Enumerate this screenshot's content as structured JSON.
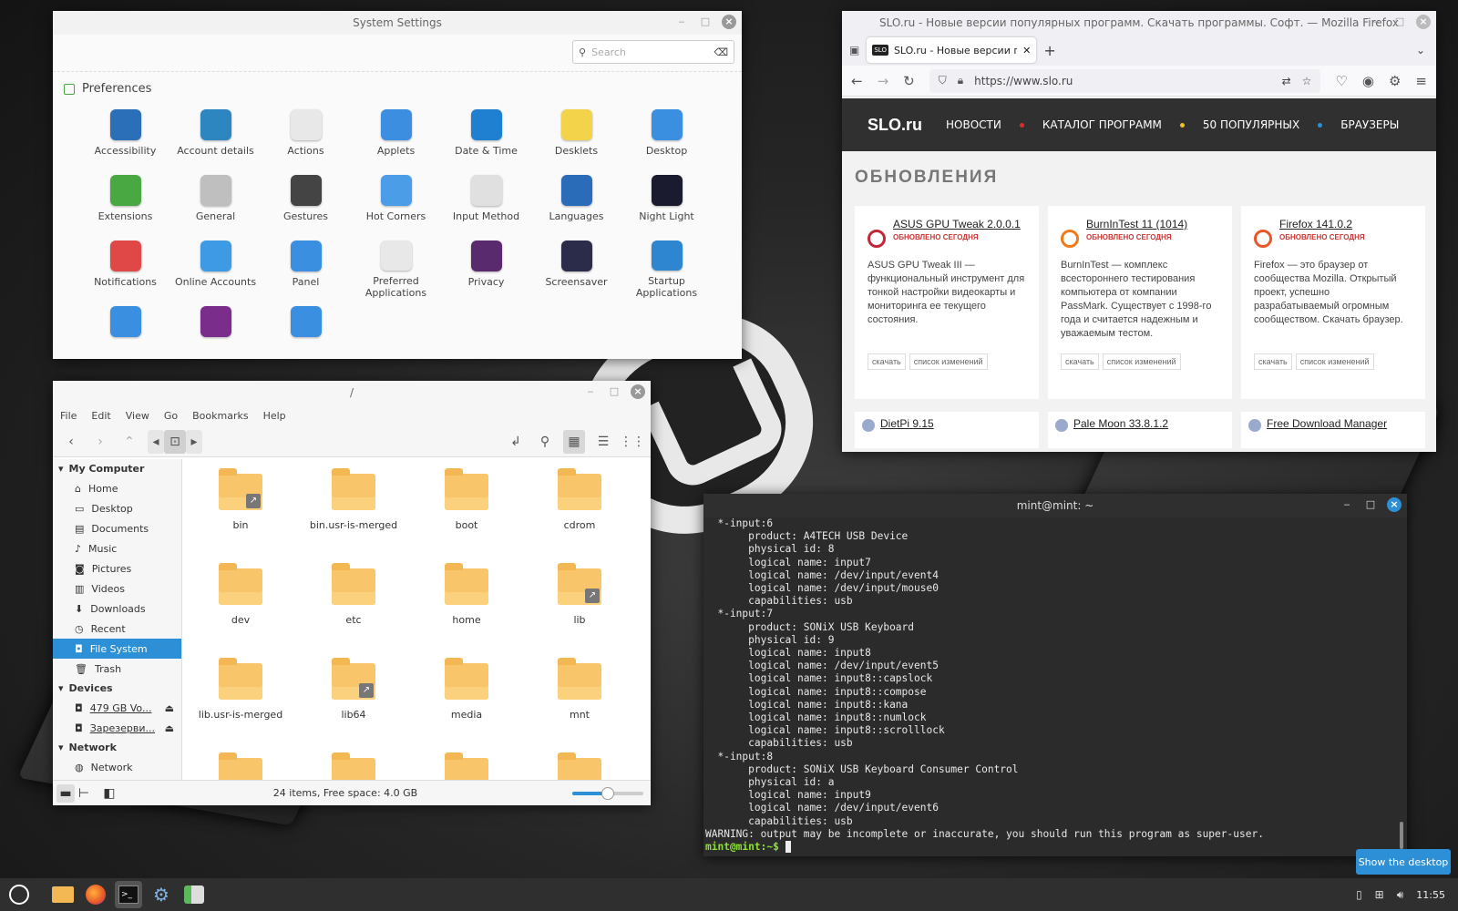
{
  "settings": {
    "title": "System Settings",
    "search_placeholder": "Search",
    "section": "Preferences",
    "items": [
      {
        "label": "Accessibility",
        "icon": "accessibility-icon",
        "color": "#2a6fb8"
      },
      {
        "label": "Account details",
        "icon": "user-icon",
        "color": "#2e86c1"
      },
      {
        "label": "Actions",
        "icon": "list-icon",
        "color": "#e8e8e8"
      },
      {
        "label": "Applets",
        "icon": "applets-icon",
        "color": "#3b8ee0"
      },
      {
        "label": "Date & Time",
        "icon": "clock-icon",
        "color": "#1f7fd1"
      },
      {
        "label": "Desklets",
        "icon": "note-icon",
        "color": "#f2d34a"
      },
      {
        "label": "Desktop",
        "icon": "desktop-icon",
        "color": "#3a8fe0"
      },
      {
        "label": "Extensions",
        "icon": "puzzle-icon",
        "color": "#4aa843"
      },
      {
        "label": "General",
        "icon": "toggle-icon",
        "color": "#bfbfbf"
      },
      {
        "label": "Gestures",
        "icon": "hand-icon",
        "color": "#444444"
      },
      {
        "label": "Hot Corners",
        "icon": "corner-icon",
        "color": "#4a9de6"
      },
      {
        "label": "Input Method",
        "icon": "input-method-icon",
        "color": "#e0e0e0"
      },
      {
        "label": "Languages",
        "icon": "globe-icon",
        "color": "#2b6cb8"
      },
      {
        "label": "Night Light",
        "icon": "moon-icon",
        "color": "#1b1b2f"
      },
      {
        "label": "Notifications",
        "icon": "bell-icon",
        "color": "#e04848"
      },
      {
        "label": "Online Accounts",
        "icon": "cloud-icon",
        "color": "#3d9be5"
      },
      {
        "label": "Panel",
        "icon": "panel-icon",
        "color": "#3a8fe0"
      },
      {
        "label": "Preferred Applications",
        "icon": "music-icon",
        "color": "#e8e8e8"
      },
      {
        "label": "Privacy",
        "icon": "mask-icon",
        "color": "#5a2a6e"
      },
      {
        "label": "Screensaver",
        "icon": "moon-star-icon",
        "color": "#2b2b4a"
      },
      {
        "label": "Startup Applications",
        "icon": "windows-icon",
        "color": "#2f86d0"
      },
      {
        "label": "",
        "icon": "windows-tile-icon",
        "color": "#3a8fe0"
      },
      {
        "label": "",
        "icon": "workspaces-icon",
        "color": "#7a2d8a"
      },
      {
        "label": "",
        "icon": "window-icon",
        "color": "#3a8fe0"
      }
    ]
  },
  "firefox": {
    "title": "SLO.ru - Новые версии популярных программ. Скачать программы. Софт. — Mozilla Firefox",
    "tab_label": "SLO.ru - Новые версии поп",
    "url": "https://www.slo.ru",
    "site_logo": "SLO.ru",
    "nav": [
      {
        "label": "НОВОСТИ",
        "dot": "#e02a2a"
      },
      {
        "label": "КАТАЛОГ ПРОГРАММ",
        "dot": "#f2c21a"
      },
      {
        "label": "50 ПОПУЛЯРНЫХ",
        "dot": "#2d8fd5"
      },
      {
        "label": "БРАУЗЕРЫ",
        "dot": ""
      }
    ],
    "heading": "ОБНОВЛЕНИЯ",
    "cards": [
      {
        "name": "ASUS GPU Tweak 2.0.0.1",
        "updated": "обновлено сегодня",
        "desc": "ASUS GPU Tweak III — функциональный инструмент для тонкой настройки видеокарты и мониторинга ее текущего состояния.",
        "btn1": "скачать",
        "btn2": "список изменений",
        "color": "#c0273a"
      },
      {
        "name": "BurnInTest 11 (1014)",
        "updated": "обновлено сегодня",
        "desc": "BurnInTest — комплекс всестороннего тестирования компьютера от компании PassMark. Существует с 1998-го года и считается надежным и уважаемым тестом.",
        "btn1": "скачать",
        "btn2": "список изменений",
        "color": "#f07a1a"
      },
      {
        "name": "Firefox 141.0.2",
        "updated": "обновлено сегодня",
        "desc": "Firefox — это браузер от сообщества Mozilla. Открытый проект, успешно разрабатываемый огромным сообществом. Скачать браузер.",
        "btn1": "скачать",
        "btn2": "список изменений",
        "color": "#e8572a"
      }
    ],
    "cards_bottom": [
      "DietPi 9.15",
      "Pale Moon 33.8.1.2",
      "Free Download Manager"
    ]
  },
  "files": {
    "title": "/",
    "menu": [
      "File",
      "Edit",
      "View",
      "Go",
      "Bookmarks",
      "Help"
    ],
    "sidebar": {
      "my_computer": "My Computer",
      "places": [
        {
          "label": "Home",
          "icon": "home-icon"
        },
        {
          "label": "Desktop",
          "icon": "desktop-icon"
        },
        {
          "label": "Documents",
          "icon": "document-icon"
        },
        {
          "label": "Music",
          "icon": "music-icon"
        },
        {
          "label": "Pictures",
          "icon": "camera-icon"
        },
        {
          "label": "Videos",
          "icon": "video-icon"
        },
        {
          "label": "Downloads",
          "icon": "download-icon"
        },
        {
          "label": "Recent",
          "icon": "clock-icon"
        },
        {
          "label": "File System",
          "icon": "drive-icon"
        },
        {
          "label": "Trash",
          "icon": "trash-icon"
        }
      ],
      "devices_header": "Devices",
      "devices": [
        "479 GB Vo...",
        "Зарезерви..."
      ],
      "network_header": "Network",
      "network": [
        "Network"
      ]
    },
    "folders": [
      {
        "name": "bin",
        "link": true
      },
      {
        "name": "bin.usr-is-merged",
        "link": false
      },
      {
        "name": "boot",
        "link": false
      },
      {
        "name": "cdrom",
        "link": false
      },
      {
        "name": "dev",
        "link": false
      },
      {
        "name": "etc",
        "link": false
      },
      {
        "name": "home",
        "link": false
      },
      {
        "name": "lib",
        "link": true
      },
      {
        "name": "lib.usr-is-merged",
        "link": false
      },
      {
        "name": "lib64",
        "link": true
      },
      {
        "name": "media",
        "link": false
      },
      {
        "name": "mnt",
        "link": false
      },
      {
        "name": "",
        "link": false
      },
      {
        "name": "",
        "link": false
      },
      {
        "name": "",
        "link": false
      },
      {
        "name": "",
        "link": false
      }
    ],
    "status": "24 items, Free space: 4.0 GB",
    "zoom_level": 0.5
  },
  "terminal": {
    "title": "mint@mint: ~",
    "lines": [
      "  *-input:6",
      "       product: A4TECH USB Device",
      "       physical id: 8",
      "       logical name: input7",
      "       logical name: /dev/input/event4",
      "       logical name: /dev/input/mouse0",
      "       capabilities: usb",
      "  *-input:7",
      "       product: SONiX USB Keyboard",
      "       physical id: 9",
      "       logical name: input8",
      "       logical name: /dev/input/event5",
      "       logical name: input8::capslock",
      "       logical name: input8::compose",
      "       logical name: input8::kana",
      "       logical name: input8::numlock",
      "       logical name: input8::scrolllock",
      "       capabilities: usb",
      "  *-input:8",
      "       product: SONiX USB Keyboard Consumer Control",
      "       physical id: a",
      "       logical name: input9",
      "       logical name: /dev/input/event6",
      "       capabilities: usb",
      "WARNING: output may be incomplete or inaccurate, you should run this program as super-user."
    ],
    "prompt": "mint@mint:~$"
  },
  "taskbar": {
    "show_desktop": "Show the desktop",
    "clock": "11:55"
  }
}
